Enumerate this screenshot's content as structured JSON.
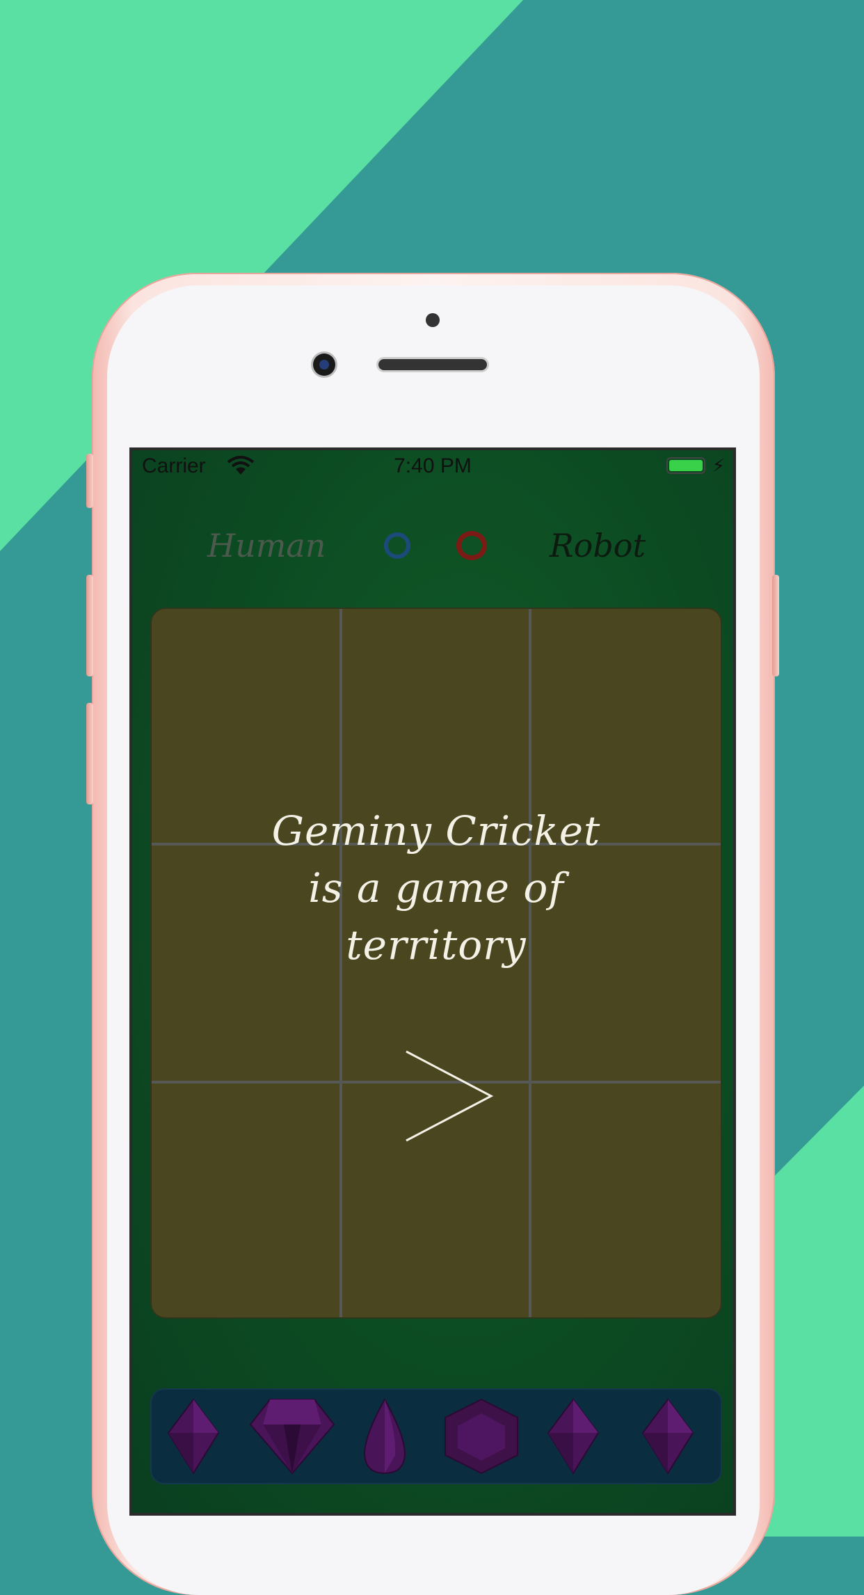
{
  "status_bar": {
    "carrier": "Carrier",
    "time": "7:40 PM",
    "battery_color": "#3ad14a"
  },
  "players": {
    "human_label": "Human",
    "robot_label": "Robot",
    "human_marker_color": "#1c4a7a",
    "robot_marker_color": "#7c1b15"
  },
  "board": {
    "rows": 3,
    "columns": 3,
    "intro_line_1": "Geminy Cricket",
    "intro_line_2": "is a game of",
    "intro_line_3": "territory",
    "next_icon": "chevron-right-icon",
    "color": "#4a461f"
  },
  "gem_tray": {
    "gems": [
      "diamond-gem-icon",
      "brilliant-gem-icon",
      "teardrop-gem-icon",
      "hexagon-gem-icon",
      "diamond-gem-icon",
      "diamond-gem-icon"
    ],
    "gem_color": "#4a1458"
  },
  "colors": {
    "background_light": "#5ae0a2",
    "background_dark": "#359a95",
    "screen": "#0c4a22"
  }
}
